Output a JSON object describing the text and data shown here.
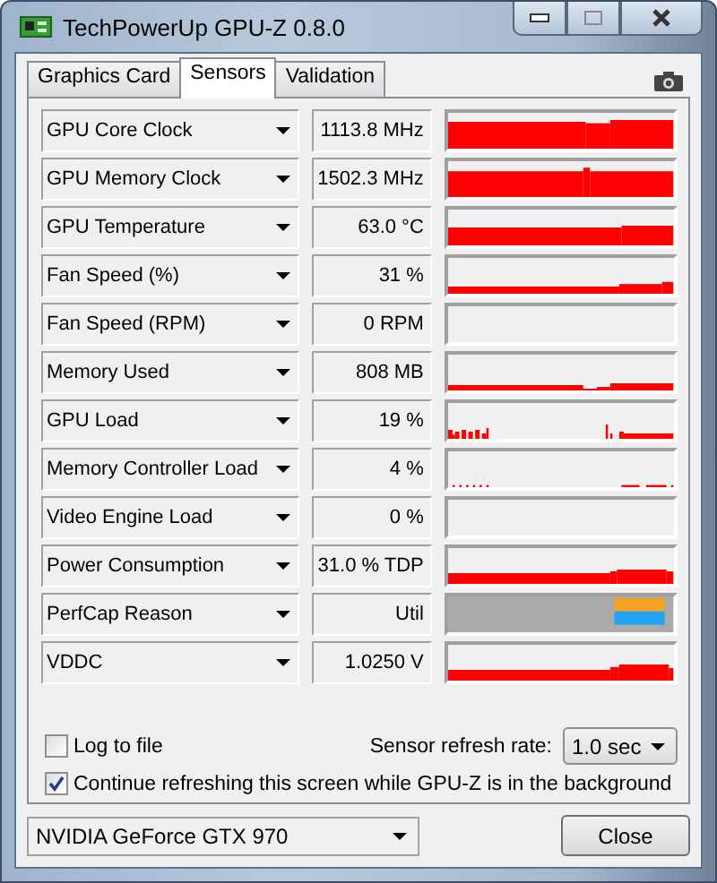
{
  "window": {
    "title": "TechPowerUp GPU-Z 0.8.0"
  },
  "tabs": [
    {
      "label": "Graphics Card",
      "selected": false
    },
    {
      "label": "Sensors",
      "selected": true
    },
    {
      "label": "Validation",
      "selected": false
    }
  ],
  "sensors": [
    {
      "name": "GPU Core Clock",
      "value": "1113.8 MHz",
      "kind": "graph"
    },
    {
      "name": "GPU Memory Clock",
      "value": "1502.3 MHz",
      "kind": "graph"
    },
    {
      "name": "GPU Temperature",
      "value": "63.0 °C",
      "kind": "graph"
    },
    {
      "name": "Fan Speed (%)",
      "value": "31 %",
      "kind": "graph"
    },
    {
      "name": "Fan Speed (RPM)",
      "value": "0 RPM",
      "kind": "graph"
    },
    {
      "name": "Memory Used",
      "value": "808 MB",
      "kind": "graph"
    },
    {
      "name": "GPU Load",
      "value": "19 %",
      "kind": "graph"
    },
    {
      "name": "Memory Controller Load",
      "value": "4 %",
      "kind": "graph"
    },
    {
      "name": "Video Engine Load",
      "value": "0 %",
      "kind": "graph"
    },
    {
      "name": "Power Consumption",
      "value": "31.0 % TDP",
      "kind": "graph"
    },
    {
      "name": "PerfCap Reason",
      "value": "Util",
      "kind": "perfcap"
    },
    {
      "name": "VDDC",
      "value": "1.0250 V",
      "kind": "graph"
    }
  ],
  "log_to_file": {
    "label": "Log to file",
    "checked": false
  },
  "refresh": {
    "label": "Sensor refresh rate:",
    "value": "1.0 sec"
  },
  "continue_refreshing": {
    "label": "Continue refreshing this screen while GPU-Z is in the background",
    "checked": true
  },
  "device": {
    "value": "NVIDIA GeForce GTX 970"
  },
  "close_button": {
    "label": "Close"
  }
}
